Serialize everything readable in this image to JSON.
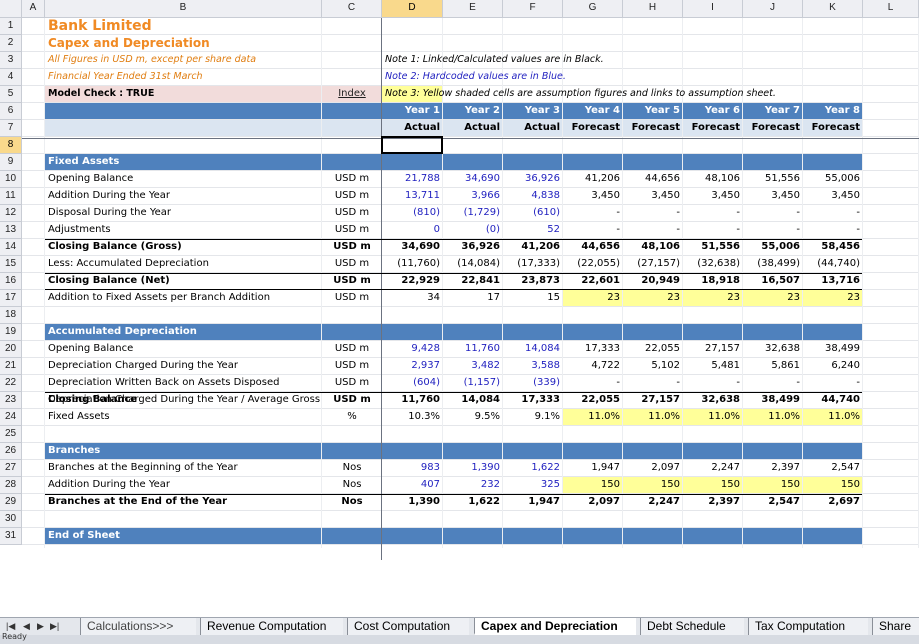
{
  "columns": [
    "A",
    "B",
    "C",
    "D",
    "E",
    "F",
    "G",
    "H",
    "I",
    "J",
    "K",
    "L"
  ],
  "selected_column": "D",
  "selected_row": "8",
  "rows": [
    "1",
    "2",
    "3",
    "4",
    "5",
    "6",
    "7",
    "8",
    "9",
    "10",
    "11",
    "12",
    "13",
    "14",
    "15",
    "16",
    "17",
    "18",
    "19",
    "20",
    "21",
    "22",
    "23",
    "24",
    "25",
    "26",
    "27",
    "28",
    "29",
    "30",
    "31"
  ],
  "title": "Bank Limited",
  "subtitle": "Capex and Depreciation",
  "note_usd": "All Figures in USD m, except per share data",
  "note_fy": "Financial Year Ended 31st March",
  "model_check": "Model Check : TRUE",
  "index_link": "Index",
  "note1": "Note 1: Linked/Calculated values are in Black.",
  "note2": "Note 2: Hardcoded values are in Blue.",
  "note3": "Note 3: Yellow shaded cells are assumption figures and links to assumption sheet.",
  "years": [
    "Year 1",
    "Year 2",
    "Year 3",
    "Year 4",
    "Year 5",
    "Year 6",
    "Year 7",
    "Year 8"
  ],
  "types": [
    "Actual",
    "Actual",
    "Actual",
    "Forecast",
    "Forecast",
    "Forecast",
    "Forecast",
    "Forecast"
  ],
  "sections": {
    "fixed": "Fixed Assets",
    "dep": "Accumulated Depreciation",
    "branches": "Branches",
    "end": "End of Sheet"
  },
  "lines": {
    "r10": {
      "label": "Opening Balance",
      "unit": "USD m",
      "vals": [
        "21,788",
        "34,690",
        "36,926",
        "41,206",
        "44,656",
        "48,106",
        "51,556",
        "55,006"
      ]
    },
    "r11": {
      "label": "Addition During the Year",
      "unit": "USD m",
      "vals": [
        "13,711",
        "3,966",
        "4,838",
        "3,450",
        "3,450",
        "3,450",
        "3,450",
        "3,450"
      ]
    },
    "r12": {
      "label": "Disposal During the Year",
      "unit": "USD m",
      "vals": [
        "(810)",
        "(1,729)",
        "(610)",
        "-",
        "-",
        "-",
        "-",
        "-"
      ]
    },
    "r13": {
      "label": "Adjustments",
      "unit": "USD m",
      "vals": [
        "0",
        "(0)",
        "52",
        "-",
        "-",
        "-",
        "-",
        "-"
      ]
    },
    "r14": {
      "label": "Closing Balance (Gross)",
      "unit": "USD m",
      "vals": [
        "34,690",
        "36,926",
        "41,206",
        "44,656",
        "48,106",
        "51,556",
        "55,006",
        "58,456"
      ]
    },
    "r15": {
      "label": "Less: Accumulated Depreciation",
      "unit": "USD m",
      "vals": [
        "(11,760)",
        "(14,084)",
        "(17,333)",
        "(22,055)",
        "(27,157)",
        "(32,638)",
        "(38,499)",
        "(44,740)"
      ]
    },
    "r16": {
      "label": "Closing Balance (Net)",
      "unit": "USD m",
      "vals": [
        "22,929",
        "22,841",
        "23,873",
        "22,601",
        "20,949",
        "18,918",
        "16,507",
        "13,716"
      ]
    },
    "r17": {
      "label": "Addition to Fixed Assets per Branch Addition",
      "unit": "USD m",
      "vals": [
        "34",
        "17",
        "15",
        "23",
        "23",
        "23",
        "23",
        "23"
      ]
    },
    "r20": {
      "label": "Opening Balance",
      "unit": "USD m",
      "vals": [
        "9,428",
        "11,760",
        "14,084",
        "17,333",
        "22,055",
        "27,157",
        "32,638",
        "38,499"
      ]
    },
    "r21": {
      "label": "Depreciation Charged During the Year",
      "unit": "USD m",
      "vals": [
        "2,937",
        "3,482",
        "3,588",
        "4,722",
        "5,102",
        "5,481",
        "5,861",
        "6,240"
      ]
    },
    "r22": {
      "label": "Depreciation Written Back on Assets Disposed",
      "unit": "USD m",
      "vals": [
        "(604)",
        "(1,157)",
        "(339)",
        "-",
        "-",
        "-",
        "-",
        "-"
      ]
    },
    "r23": {
      "label": "Closing Balance",
      "unit": "USD m",
      "vals": [
        "11,760",
        "14,084",
        "17,333",
        "22,055",
        "27,157",
        "32,638",
        "38,499",
        "44,740"
      ]
    },
    "r24": {
      "label1": "Depreciation Charged During the Year / Average Gross",
      "label2": "Fixed Assets",
      "unit": "%",
      "vals": [
        "10.3%",
        "9.5%",
        "9.1%",
        "11.0%",
        "11.0%",
        "11.0%",
        "11.0%",
        "11.0%"
      ]
    },
    "r27": {
      "label": "Branches at the Beginning of the Year",
      "unit": "Nos",
      "vals": [
        "983",
        "1,390",
        "1,622",
        "1,947",
        "2,097",
        "2,247",
        "2,397",
        "2,547"
      ]
    },
    "r28": {
      "label": "Addition During the Year",
      "unit": "Nos",
      "vals": [
        "407",
        "232",
        "325",
        "150",
        "150",
        "150",
        "150",
        "150"
      ]
    },
    "r29": {
      "label": "Branches at the End of the Year",
      "unit": "Nos",
      "vals": [
        "1,390",
        "1,622",
        "1,947",
        "2,097",
        "2,247",
        "2,397",
        "2,547",
        "2,697"
      ]
    }
  },
  "tabs": [
    "Calculations>>>",
    "Revenue Computation",
    "Cost Computation",
    "Capex and Depreciation",
    "Debt Schedule",
    "Tax Computation",
    "Share C"
  ],
  "active_tab": "Capex and Depreciation",
  "status_text": "Ready",
  "colors": {
    "band": "#4f81bd",
    "header_fill": "#dbe5f1",
    "yellow": "#ffff99",
    "pink": "#f2dcdb",
    "title": "#f08a24",
    "hardcoded": "#1f1fbf"
  }
}
